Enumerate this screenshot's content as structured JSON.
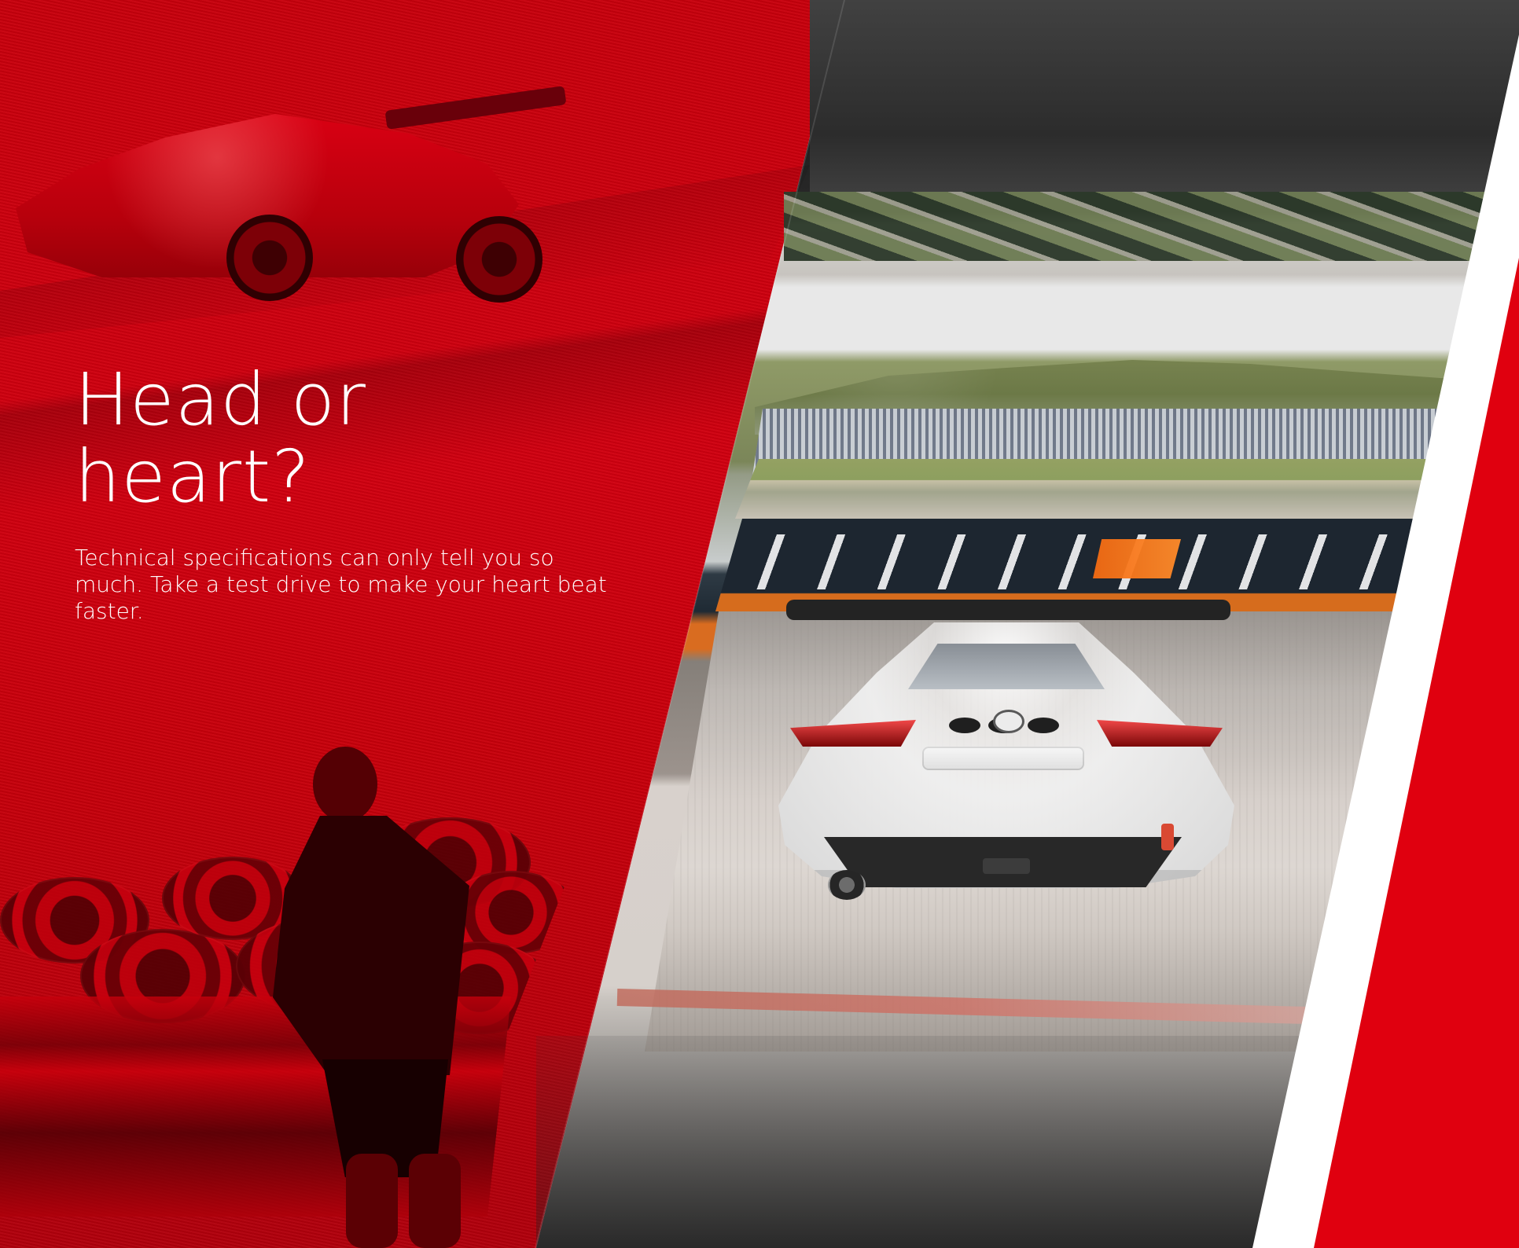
{
  "page": {
    "headline": "Head or heart?",
    "body": "Technical specifications can only tell you so much. Take a test drive to make your heart beat faster."
  },
  "colors": {
    "brand_red": "#d10010",
    "accent_red": "#e0000f",
    "white": "#ffffff"
  }
}
